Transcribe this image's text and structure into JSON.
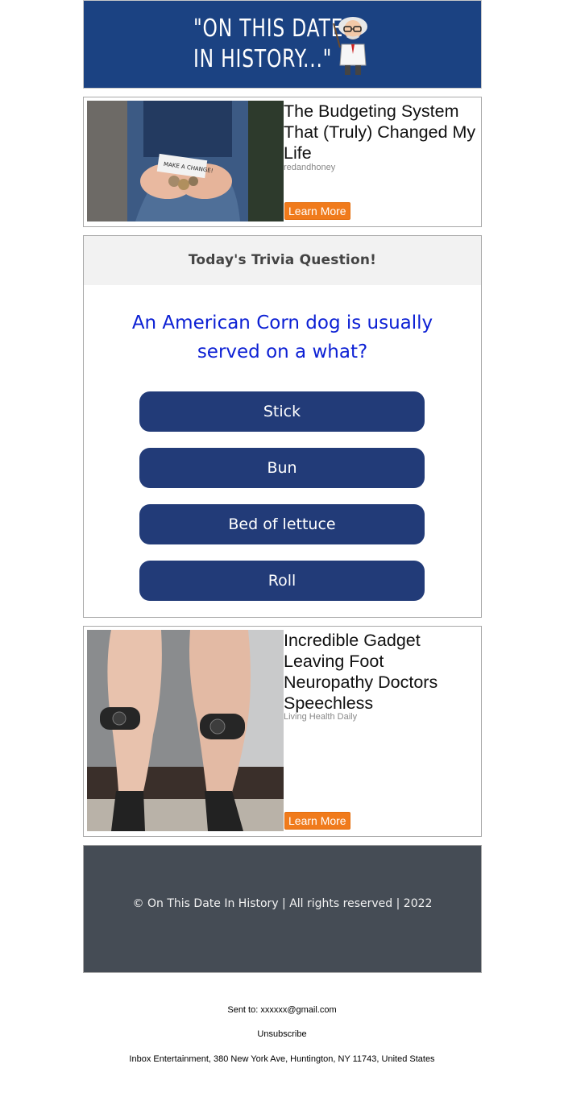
{
  "header": {
    "logo_line1": "\"ON THIS DATE",
    "logo_line2": "IN HISTORY...\"",
    "mascot_icon": "professor-mascot-icon"
  },
  "ads": [
    {
      "title": "The Budgeting System That (Truly) Changed My Life",
      "source": "redandhoney",
      "button": "Learn More",
      "image_note_text": "MAKE A CHANGE!"
    },
    {
      "title": "Incredible Gadget Leaving Foot Neuropathy Doctors Speechless",
      "source": "Living Health Daily",
      "button": "Learn More"
    }
  ],
  "trivia": {
    "heading": "Today's Trivia Question!",
    "question": "An American Corn dog is usually served on a what?",
    "answers": [
      "Stick",
      "Bun",
      "Bed of lettuce",
      "Roll"
    ]
  },
  "footer": {
    "copyright": "© On This Date In History | All rights reserved | 2022"
  },
  "meta": {
    "sent_to": "Sent to: xxxxxx@gmail.com",
    "unsubscribe": "Unsubscribe",
    "address": "Inbox Entertainment, 380 New York Ave, Huntington, NY 11743, United States"
  },
  "colors": {
    "header_bg": "#1b4282",
    "answer_button": "#223b78",
    "question_text": "#0b1fd4",
    "learn_more": "#f07b1c",
    "footer_bg": "#454c55"
  }
}
